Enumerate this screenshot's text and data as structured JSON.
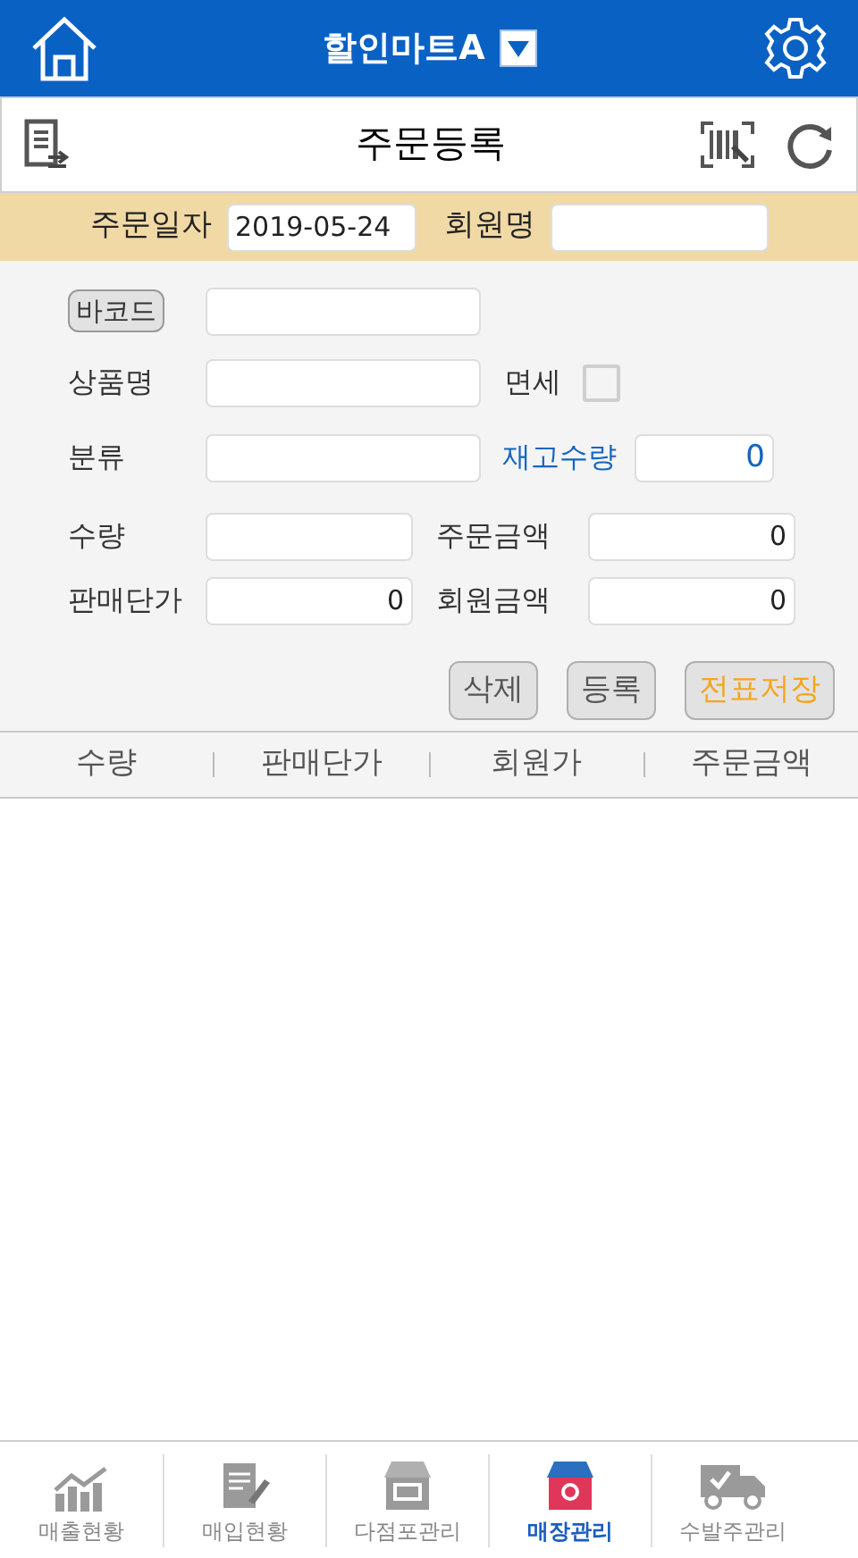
{
  "header": {
    "store": "할인마트A"
  },
  "title_bar": {
    "title": "주문등록"
  },
  "order_bar": {
    "date_label": "주문일자",
    "date": "2019-05-24",
    "member_label": "회원명"
  },
  "form": {
    "barcode_button": "바코드",
    "product_label": "상품명",
    "tax_free_label": "면세",
    "tax_free_checked": false,
    "category_label": "분류",
    "stock_label": "재고수량",
    "stock_value": "0",
    "qty_label": "수량",
    "order_amount_label": "주문금액",
    "order_amount": "0",
    "price_label": "판매단가",
    "price": "0",
    "member_amount_label": "회원금액",
    "member_amount": "0"
  },
  "buttons": [
    {
      "label": "삭제",
      "kind": "normal"
    },
    {
      "label": "등록",
      "kind": "normal"
    },
    {
      "label": "전표저장",
      "kind": "save"
    }
  ],
  "table": {
    "columns": [
      "수량",
      "판매단가",
      "회원가",
      "주문금액"
    ]
  },
  "bottom_nav": [
    {
      "label": "매출현황",
      "kind": "chart",
      "selected": false
    },
    {
      "label": "매입현황",
      "kind": "document",
      "selected": false
    },
    {
      "label": "다점포관리",
      "kind": "store",
      "selected": false
    },
    {
      "label": "매장관리",
      "kind": "store",
      "selected": true
    },
    {
      "label": "수발주관리",
      "kind": "truck",
      "selected": false
    }
  ]
}
